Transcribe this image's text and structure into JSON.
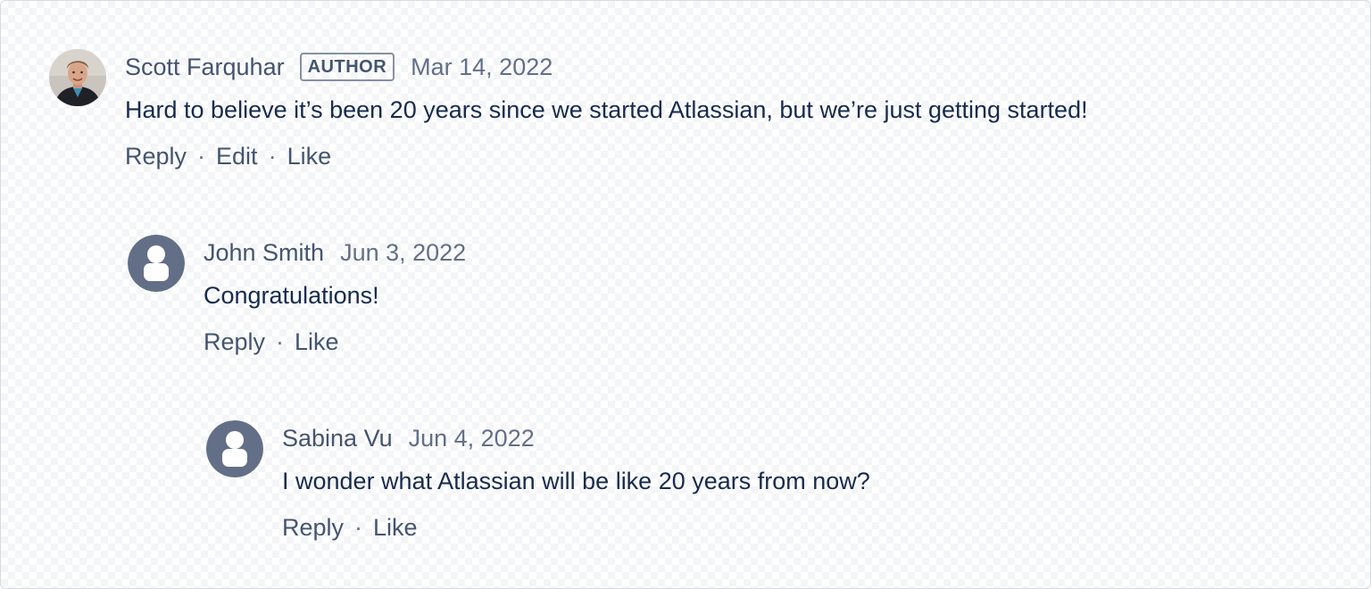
{
  "comments": [
    {
      "author": "Scott Farquhar",
      "badge": "AUTHOR",
      "date": "Mar 14, 2022",
      "text": "Hard to believe it’s been 20 years since we started Atlassian, but we’re just getting started!",
      "actions": [
        "Reply",
        "Edit",
        "Like"
      ],
      "avatar_icon": "user-photo-avatar"
    },
    {
      "author": "John Smith",
      "date": "Jun 3, 2022",
      "text": "Congratulations!",
      "actions": [
        "Reply",
        "Like"
      ],
      "avatar_icon": "person-placeholder-icon"
    },
    {
      "author": "Sabina Vu",
      "date": "Jun 4, 2022",
      "text": "I wonder what Atlassian will be like 20 years from now?",
      "actions": [
        "Reply",
        "Like"
      ],
      "avatar_icon": "person-placeholder-icon"
    }
  ],
  "separator": "·",
  "colors": {
    "placeholder_avatar": "#626f86",
    "author_text": "#44546f",
    "body_text": "#172b4d",
    "badge_border": "#8590a2"
  }
}
